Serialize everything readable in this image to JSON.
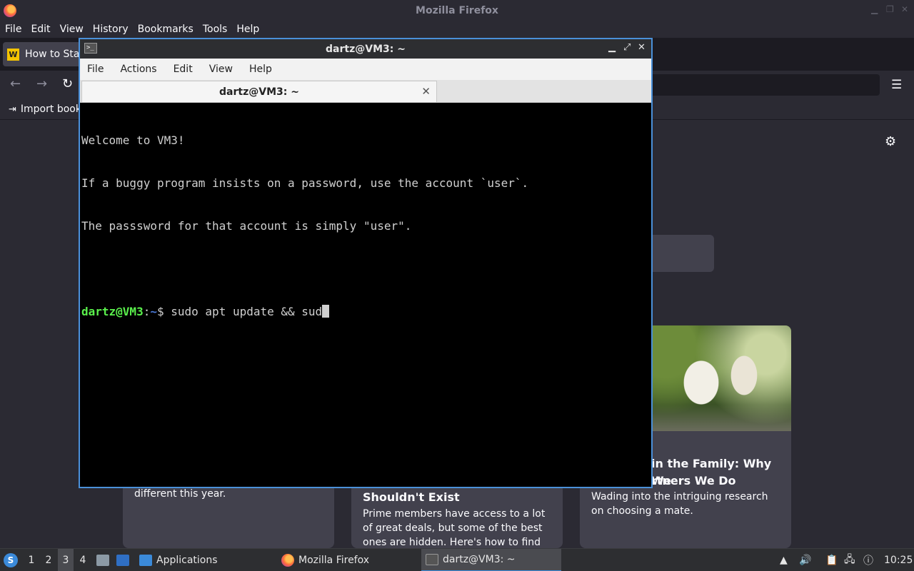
{
  "firefox": {
    "window_title": "Mozilla Firefox",
    "menu": [
      "File",
      "Edit",
      "View",
      "History",
      "Bookmarks",
      "Tools",
      "Help"
    ],
    "tab": {
      "favicon": "W",
      "title": "How to Start"
    },
    "bookmarks": {
      "import_label": "Import bookmarks"
    },
    "cards": [
      {
        "desc": "different this year."
      },
      {
        "title": "Shouldn't Exist",
        "desc": "Prime members have access to a lot of great deals, but some of the best ones are hidden. Here's how to find them."
      },
      {
        "title_line1": "in the Family: Why We",
        "title_line2": "rtners We Do",
        "desc": "Wading into the intriguing research on choosing a mate."
      }
    ]
  },
  "terminal": {
    "window_title": "dartz@VM3: ~",
    "menu": [
      "File",
      "Actions",
      "Edit",
      "View",
      "Help"
    ],
    "tab_title": "dartz@VM3: ~",
    "lines": [
      "Welcome to VM3!",
      "If a buggy program insists on a password, use the account `user`.",
      "The passsword for that account is simply \"user\"."
    ],
    "prompt": {
      "user_host": "dartz@VM3",
      "sep": ":",
      "path": "~",
      "symbol": "$",
      "command": " sudo apt update && sud"
    }
  },
  "taskbar": {
    "workspaces": [
      "1",
      "2",
      "3",
      "4"
    ],
    "active_workspace": "3",
    "apps_label": "Applications",
    "tasks": [
      "Mozilla Firefox",
      "dartz@VM3: ~"
    ],
    "clock": "10:25"
  }
}
